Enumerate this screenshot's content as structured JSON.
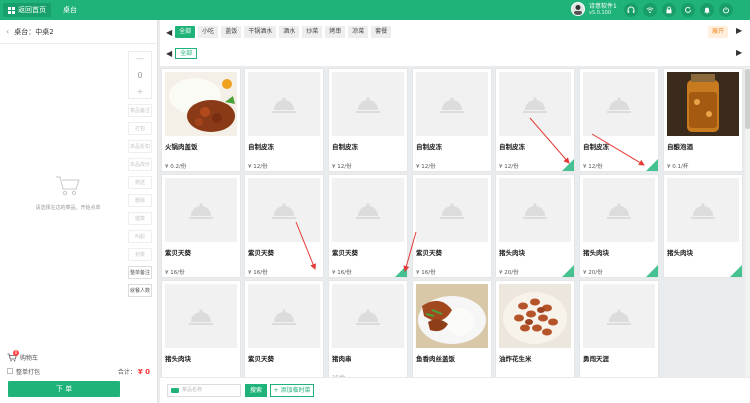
{
  "header": {
    "home_label": "返回首页",
    "nav_tab": "桌台",
    "user_name": "诗意软件1",
    "user_version": "v5.0.100",
    "icons": [
      "headset-icon",
      "wifi-icon",
      "lock-icon",
      "refresh-icon",
      "bell-icon",
      "power-icon"
    ]
  },
  "left": {
    "table_label": "桌台：中桌2",
    "qty_value": "0",
    "qty_minus": "—",
    "qty_plus": "+",
    "ops": [
      "菜品备注",
      "打包",
      "单品折扣",
      "单品改价",
      "赠送",
      "删除",
      "催菜",
      "叫起",
      "划菜"
    ],
    "ops_dark": [
      "整单备注",
      "就餐人数"
    ],
    "empty_text": "请选择左边的菜品，开始点单",
    "cart_label": "购物车",
    "cart_count": "0",
    "whole_pack": "整单打包",
    "total_label": "合计：",
    "total_amount": "¥ 0",
    "order_button": "下 单"
  },
  "categories": {
    "items": [
      "全部",
      "小吃",
      "盖饭",
      "干锅酒水",
      "酒水",
      "炒菜",
      "烤串",
      "凉菜",
      "套餐"
    ],
    "active": "全部",
    "fold": "展开",
    "sub_items": [
      "全部"
    ]
  },
  "dishes": [
    {
      "name": "火锅肉盖饭",
      "price": "¥ 0.2/份",
      "img": "rice-dish",
      "tag": false
    },
    {
      "name": "自制皮冻",
      "price": "¥ 12/份",
      "img": "placeholder",
      "tag": false
    },
    {
      "name": "自制皮冻",
      "price": "¥ 12/份",
      "img": "placeholder",
      "tag": false
    },
    {
      "name": "自制皮冻",
      "price": "¥ 12/份",
      "img": "placeholder",
      "tag": false
    },
    {
      "name": "自制皮冻",
      "price": "¥ 12/份",
      "img": "placeholder",
      "tag": true
    },
    {
      "name": "自制皮冻",
      "price": "¥ 12/份",
      "img": "placeholder",
      "tag": true
    },
    {
      "name": "自酿泡酒",
      "price": "¥ 0.1/杯",
      "img": "wine-jar",
      "tag": false
    },
    {
      "name": "紫贝天葵",
      "price": "¥ 16/份",
      "img": "placeholder",
      "tag": false
    },
    {
      "name": "紫贝天葵",
      "price": "¥ 16/份",
      "img": "placeholder",
      "tag": false
    },
    {
      "name": "紫贝天葵",
      "price": "¥ 16/份",
      "img": "placeholder",
      "tag": true
    },
    {
      "name": "紫贝天葵",
      "price": "¥ 16/份",
      "img": "placeholder",
      "tag": false
    },
    {
      "name": "猪头肉块",
      "price": "¥ 20/份",
      "img": "placeholder",
      "tag": true
    },
    {
      "name": "猪头肉块",
      "price": "¥ 20/份",
      "img": "placeholder",
      "tag": true
    },
    {
      "name": "猪头肉块",
      "price": "",
      "img": "placeholder",
      "tag": true
    },
    {
      "name": "猪头肉块",
      "price": "",
      "img": "placeholder",
      "tag": false
    },
    {
      "name": "紫贝天葵",
      "price": "",
      "img": "placeholder",
      "tag": false
    },
    {
      "name": "猪肉串",
      "price": "",
      "hint": "16/份",
      "img": "placeholder",
      "tag": false
    },
    {
      "name": "鱼香肉丝盖饭",
      "price": "",
      "img": "fish-rice",
      "tag": false
    },
    {
      "name": "油炸花生米",
      "price": "",
      "img": "peanuts",
      "tag": false
    },
    {
      "name": "勇闯天涯",
      "price": "",
      "img": "placeholder",
      "tag": false
    }
  ],
  "bottom": {
    "search_placeholder": "菜品名称",
    "search_button": "搜索",
    "add_button": "+ 添加临时菜"
  },
  "colors": {
    "brand": "#1fb37a",
    "accent_orange": "#f08a24",
    "price_red": "#ff3333"
  }
}
